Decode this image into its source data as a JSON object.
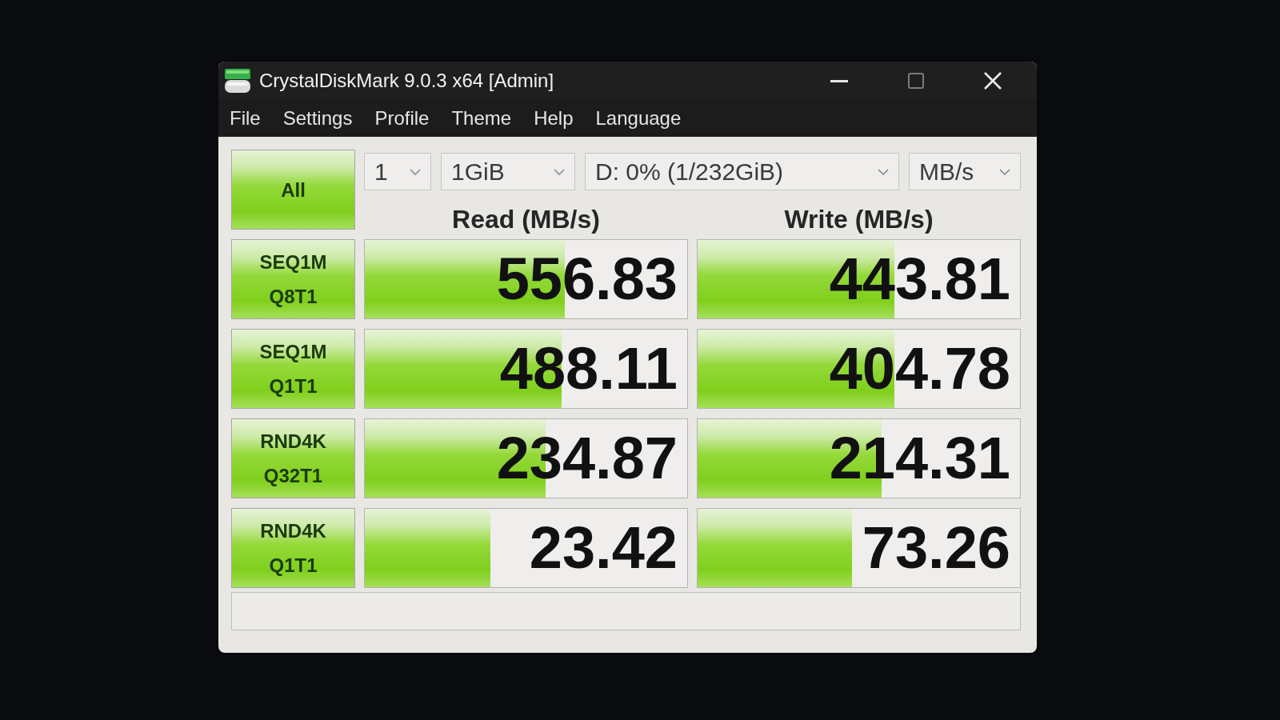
{
  "window": {
    "title": "CrystalDiskMark 9.0.3 x64 [Admin]"
  },
  "menu": [
    "File",
    "Settings",
    "Profile",
    "Theme",
    "Help",
    "Language"
  ],
  "all_button": {
    "label": "All"
  },
  "dropdowns": [
    {
      "value": "1"
    },
    {
      "value": "1GiB"
    },
    {
      "value": "D: 0% (1/232GiB)"
    },
    {
      "value": "MB/s"
    }
  ],
  "columns": [
    "Read (MB/s)",
    "Write (MB/s)"
  ],
  "rows": [
    {
      "label_lines": [
        "SEQ1M",
        "Q8T1"
      ],
      "read": {
        "value": "556.83",
        "level": 0.62
      },
      "write": {
        "value": "443.81",
        "level": 0.61
      }
    },
    {
      "label_lines": [
        "SEQ1M",
        "Q1T1"
      ],
      "read": {
        "value": "488.11",
        "level": 0.61
      },
      "write": {
        "value": "404.78",
        "level": 0.61
      }
    },
    {
      "label_lines": [
        "RND4K",
        "Q32T1"
      ],
      "read": {
        "value": "234.87",
        "level": 0.56
      },
      "write": {
        "value": "214.31",
        "level": 0.57
      }
    },
    {
      "label_lines": [
        "RND4K",
        "Q1T1"
      ],
      "read": {
        "value": "23.42",
        "level": 0.39
      },
      "write": {
        "value": "73.26",
        "level": 0.48
      }
    }
  ]
}
